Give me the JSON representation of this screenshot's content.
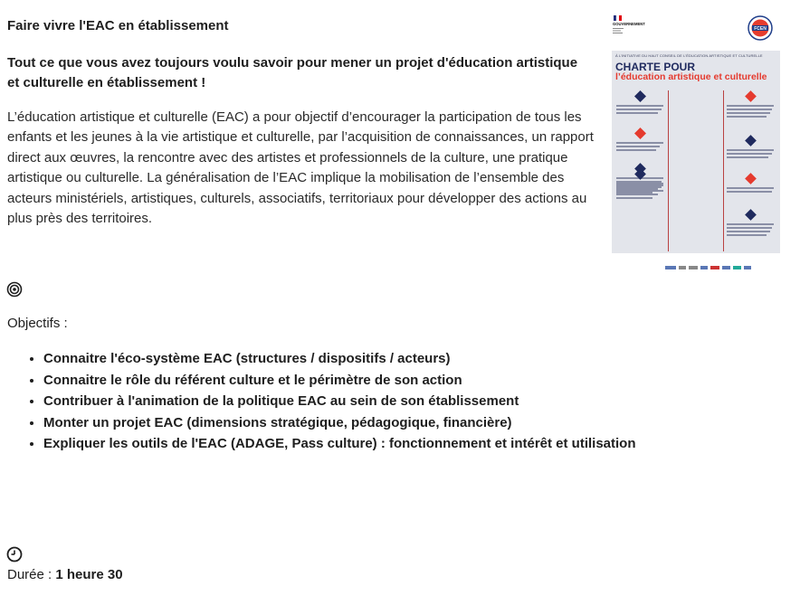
{
  "page": {
    "title": "Faire vivre l'EAC en établissement",
    "subtitle": "Tout ce que vous avez toujours voulu savoir pour mener un projet d'éducation artistique et culturelle en établissement !",
    "intro": "L’éducation artistique et culturelle (EAC) a pour objectif d’encourager la participation de tous les enfants et les jeunes à la vie artistique et culturelle, par l’acquisition de connaissances, un rapport direct aux œuvres, la rencontre avec des artistes et professionnels de la culture, une pratique artistique ou culturelle. La généralisation de l’EAC implique la mobilisation de l’ensemble des acteurs ministériels, artistiques, culturels, associatifs, territoriaux pour développer des actions au plus près des territoires."
  },
  "objectives": {
    "label": "Objectifs :",
    "items": [
      "Connaitre l'éco-système EAC (structures / dispositifs / acteurs)",
      "Connaitre le rôle du référent culture et le périmètre de son action",
      "Contribuer à l'animation de la politique EAC au sein de son établissement",
      "Monter un projet EAC (dimensions stratégique, pédagogique, financière)",
      "Expliquer les outils de l'EAC (ADAGE, Pass culture) : fonctionnement et intérêt et utilisation"
    ]
  },
  "duration": {
    "label": "Durée : ",
    "value": "1 heure 30"
  },
  "poster": {
    "kicker": "À L’INITIATIVE DU HAUT CONSEIL DE L’ÉDUCATION ARTISTIQUE ET CULTURELLE",
    "title": "CHARTE POUR",
    "subtitle": "l’éducation artistique et culturelle",
    "accent_red": "#e53a2e",
    "accent_navy": "#1f2a5e"
  },
  "logos": {
    "government": "GOUVERNEMENT",
    "emblem": "FCEN"
  },
  "icons": {
    "objectives": "target-icon",
    "duration": "clock-icon"
  }
}
